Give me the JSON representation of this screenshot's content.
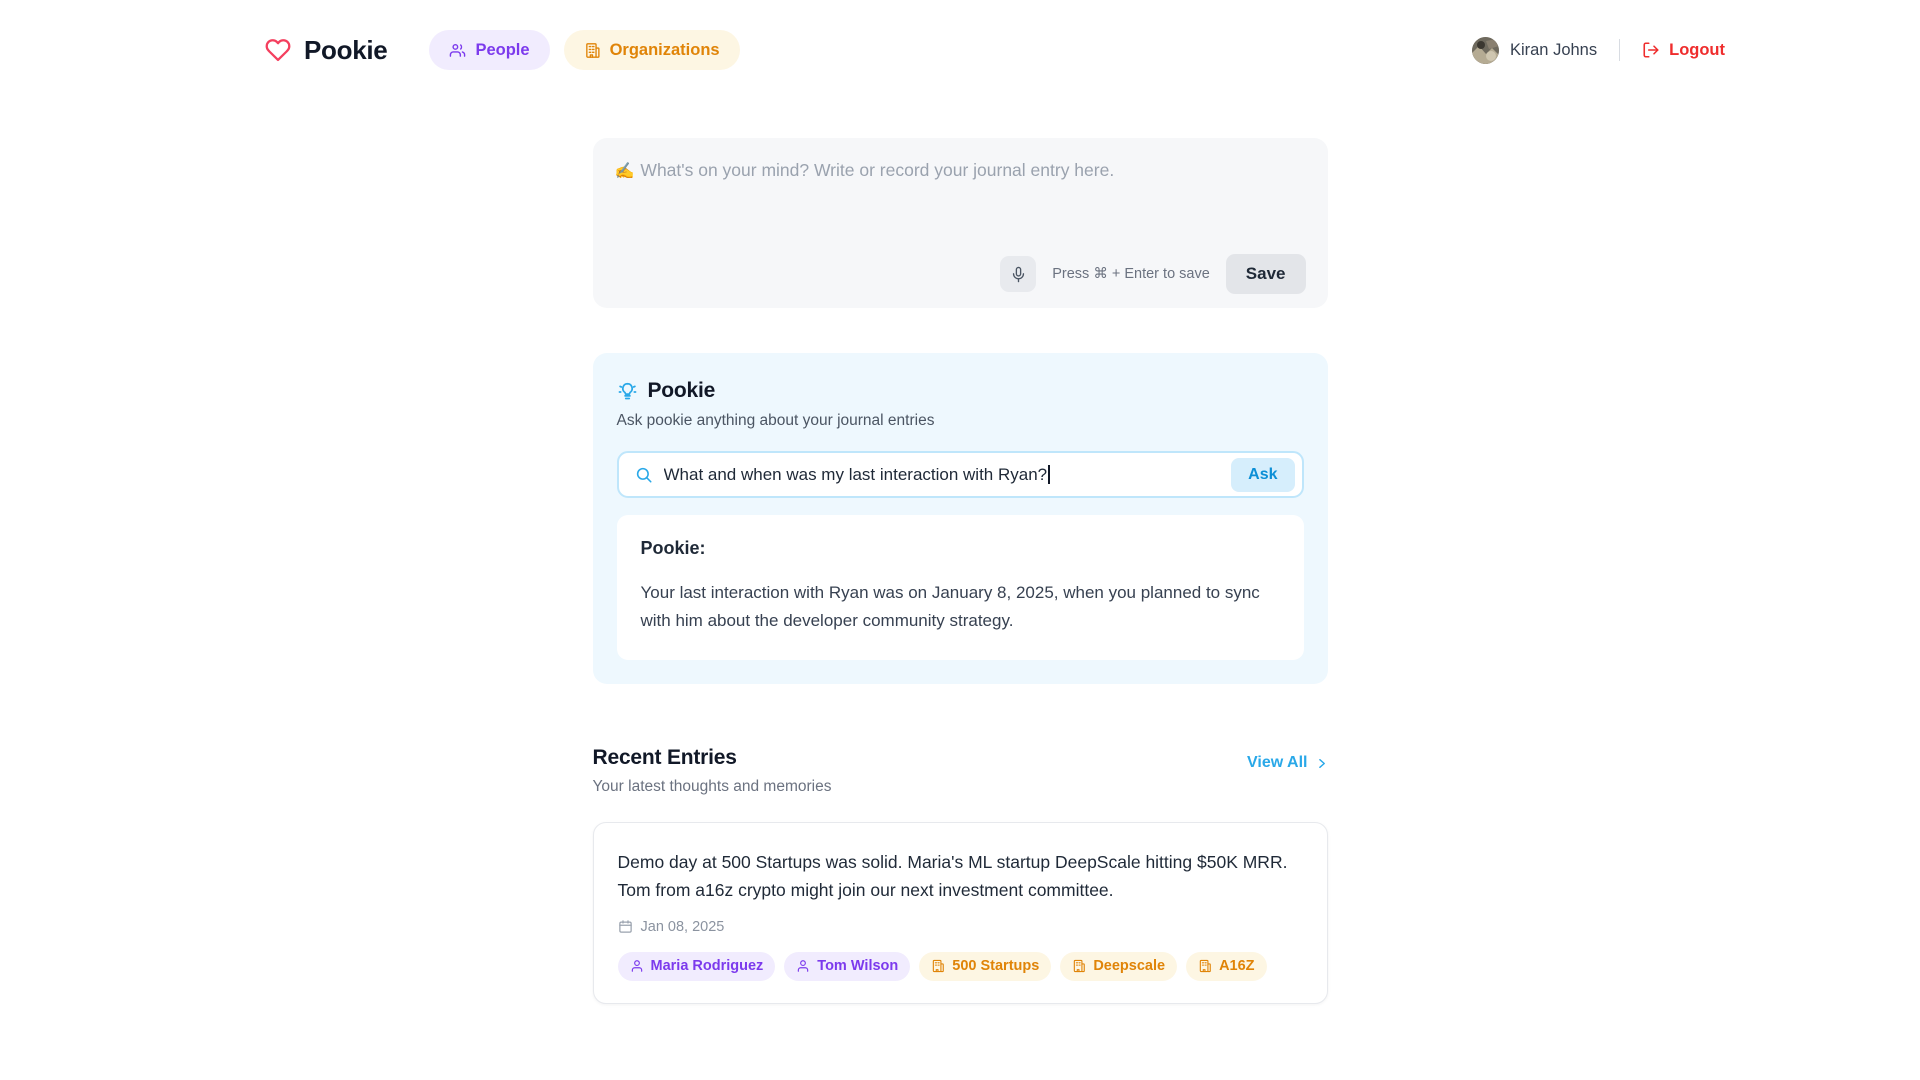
{
  "header": {
    "brand": {
      "name": "Pookie",
      "icon": "heart-icon",
      "color": "#f43f5e"
    },
    "nav": [
      {
        "label": "People",
        "icon": "people-icon",
        "color": "#7c3aed",
        "bg": "#f1ecfe"
      },
      {
        "label": "Organizations",
        "icon": "building-icon",
        "color": "#e08408",
        "bg": "#fdf6e3"
      }
    ],
    "user": {
      "name": "Kiran Johns",
      "avatar": "user-avatar"
    },
    "logout": {
      "label": "Logout",
      "icon": "logout-icon",
      "color": "#ef2d2d"
    }
  },
  "composer": {
    "emoji": "✍️",
    "placeholder": "What's on your mind? Write or record your journal entry here.",
    "value": "",
    "mic_icon": "microphone-icon",
    "hint": "Press ⌘ + Enter to save",
    "save_label": "Save"
  },
  "assistant": {
    "icon": "lightbulb-icon",
    "title": "Pookie",
    "subtitle": "Ask pookie anything about your journal entries",
    "search_icon": "search-icon",
    "question": "What and when was my last interaction with Ryan?",
    "placeholder": "Ask pookie anything about your journal entries",
    "ask_label": "Ask",
    "answer_label": "Pookie:",
    "answer_text": "Your last interaction with Ryan was on January 8, 2025, when you planned to sync with him about the developer community strategy.",
    "accent": "#29a8e8"
  },
  "recent": {
    "title": "Recent Entries",
    "subtitle": "Your latest thoughts and memories",
    "view_all_label": "View All",
    "view_all_icon": "chevron-right-icon",
    "entries": [
      {
        "text": "Demo day at 500 Startups was solid. Maria's ML startup DeepScale hitting $50K MRR. Tom from a16z crypto might join our next investment committee.",
        "date": "Jan 08, 2025",
        "date_icon": "calendar-icon",
        "tags": [
          {
            "label": "Maria Rodriguez",
            "type": "person",
            "icon": "person-icon"
          },
          {
            "label": "Tom Wilson",
            "type": "person",
            "icon": "person-icon"
          },
          {
            "label": "500 Startups",
            "type": "org",
            "icon": "building-icon"
          },
          {
            "label": "Deepscale",
            "type": "org",
            "icon": "building-icon"
          },
          {
            "label": "A16Z",
            "type": "org",
            "icon": "building-icon"
          }
        ]
      }
    ]
  }
}
